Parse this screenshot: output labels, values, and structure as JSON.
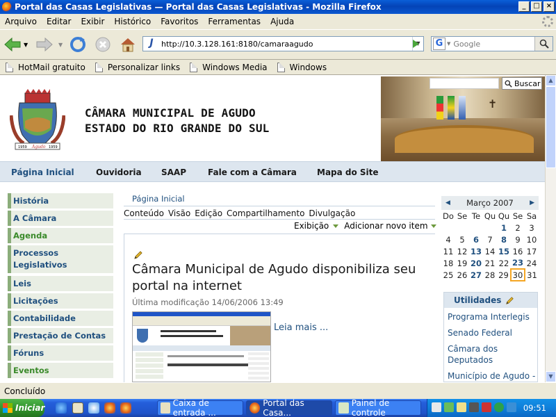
{
  "window": {
    "title": "Portal das Casas Legislativas — Portal das Casas Legislativas - Mozilla Firefox",
    "min_glyph": "_",
    "max_glyph": "□",
    "close_glyph": "×"
  },
  "menu": [
    "Arquivo",
    "Editar",
    "Exibir",
    "Histórico",
    "Favoritos",
    "Ferramentas",
    "Ajuda"
  ],
  "toolbar": {
    "url": "http://10.3.128.161:8180/camaraagudo",
    "search_placeholder": "Google",
    "search_engine_glyph": "G",
    "site_glyph": "J"
  },
  "bookmarks": [
    "HotMail gratuito",
    "Personalizar links",
    "Windows Media",
    "Windows"
  ],
  "site": {
    "name_line1": "CÂMARA MUNICIPAL DE AGUDO",
    "name_line2": "ESTADO DO RIO GRANDE DO SUL",
    "crest_text": "Agudo",
    "crest_year_left": "1959",
    "crest_year_right": "1959",
    "search_button": "Buscar",
    "topnav": [
      "Página Inicial",
      "Ouvidoria",
      "SAAP",
      "Fale com a Câmara",
      "Mapa do Site"
    ],
    "leftmenu": [
      {
        "label": "História"
      },
      {
        "label": "A Câmara"
      },
      {
        "label": "Agenda"
      },
      {
        "label": "Processos Legislativos"
      },
      {
        "label": "Leis"
      },
      {
        "label": "Licitações"
      },
      {
        "label": "Contabilidade"
      },
      {
        "label": "Prestação de Contas"
      },
      {
        "label": "Fóruns"
      },
      {
        "label": "Eventos"
      }
    ]
  },
  "content": {
    "breadcrumb": "Página Inicial",
    "tabs": [
      "Conteúdo",
      "Visão",
      "Edição",
      "Compartilhamento",
      "Divulgação"
    ],
    "action_view": "Exibição",
    "action_add": "Adicionar novo item",
    "title": "Câmara Municipal de Agudo disponibiliza seu portal na internet",
    "modified": "Última modificação 14/06/2006 13:49",
    "read_more": "Leia mais ..."
  },
  "calendar": {
    "month": "Março 2007",
    "days": [
      "Do",
      "Se",
      "Te",
      "Qu",
      "Qu",
      "Se",
      "Sa"
    ],
    "weeks": [
      [
        "",
        "",
        "",
        "",
        "1",
        "2",
        "3"
      ],
      [
        "4",
        "5",
        "6",
        "7",
        "8",
        "9",
        "10"
      ],
      [
        "11",
        "12",
        "13",
        "14",
        "15",
        "16",
        "17"
      ],
      [
        "18",
        "19",
        "20",
        "21",
        "22",
        "23",
        "24"
      ],
      [
        "25",
        "26",
        "27",
        "28",
        "29",
        "30",
        "31"
      ]
    ],
    "linked_days": [
      "1",
      "6",
      "8",
      "13",
      "15",
      "20",
      "23",
      "27"
    ],
    "today": "30"
  },
  "utilities": {
    "title": "Utilidades",
    "items": [
      "Programa Interlegis",
      "Senado Federal",
      "Câmara dos Deputados",
      "Município de Agudo -"
    ]
  },
  "status": "Concluído",
  "taskbar": {
    "start": "Iniciar",
    "tasks": [
      "Caixa de entrada ...",
      "Portal das Casa...",
      "Painel de controle"
    ],
    "clock": "09:51"
  },
  "colors": {
    "accent_blue": "#20507f",
    "menu_green": "#8bad7a",
    "today_highlight": "#f5a623"
  }
}
